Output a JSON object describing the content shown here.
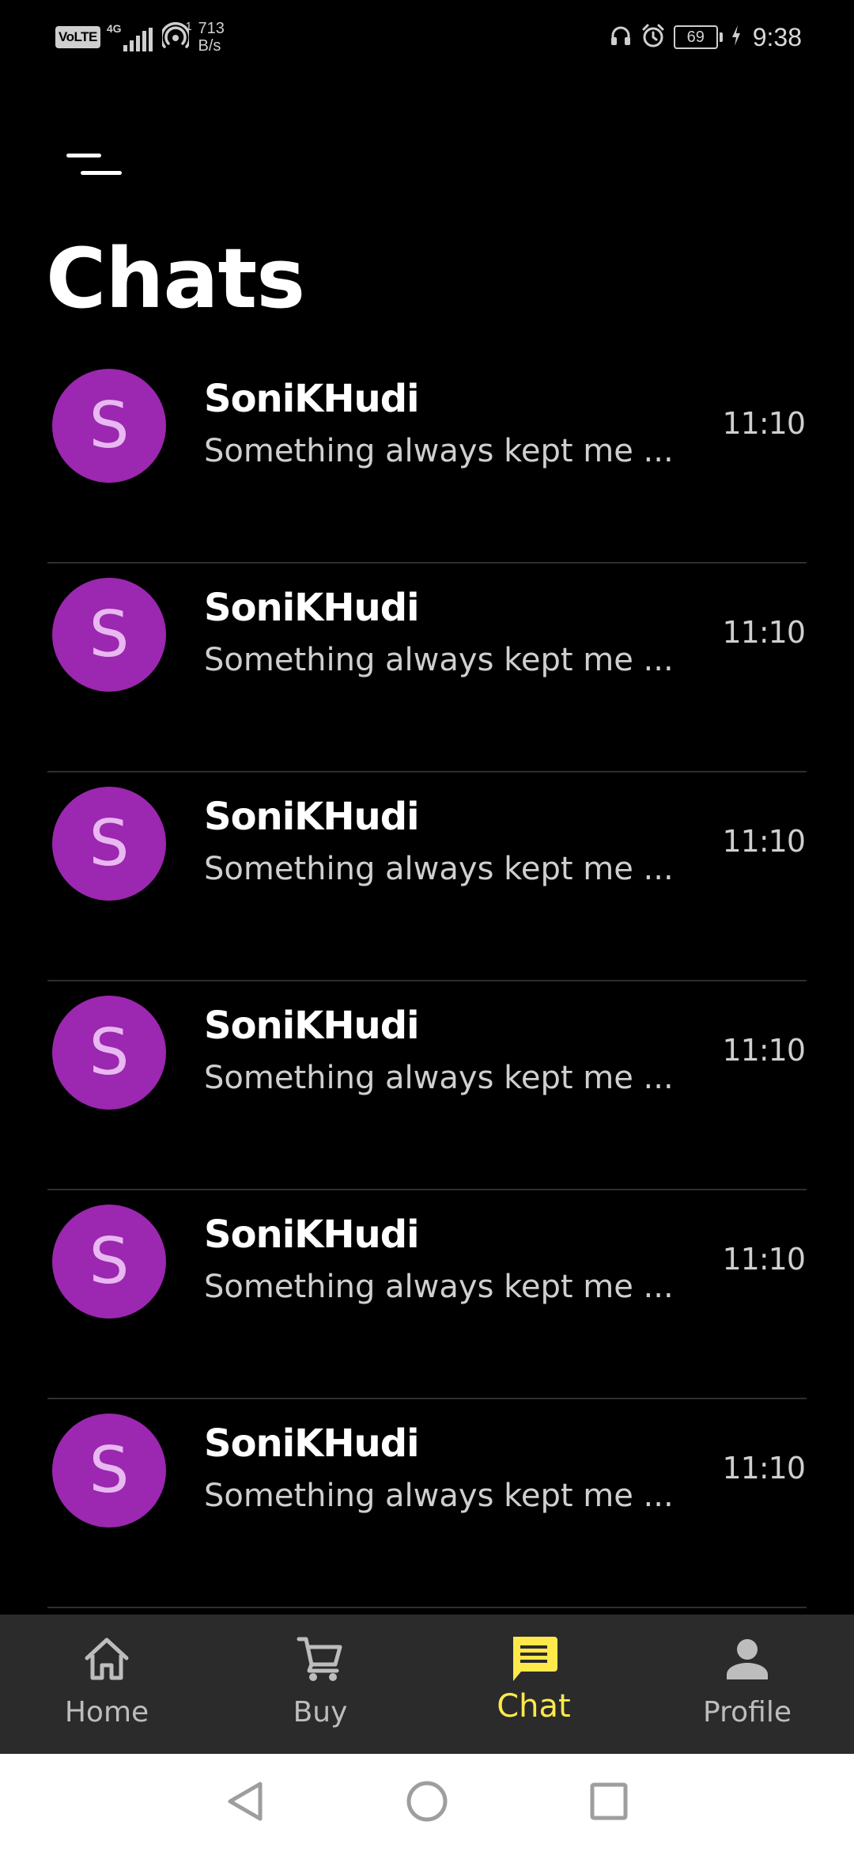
{
  "status_bar": {
    "volte": "VoLTE",
    "network": "4G",
    "speed_sup": "1",
    "speed_value": "713",
    "speed_unit": "B/s",
    "battery": "69",
    "time": "9:38"
  },
  "header": {
    "title": "Chats"
  },
  "chats": [
    {
      "avatar_letter": "S",
      "name": "SoniKHudi",
      "preview": "Something always kept me ...",
      "time": "11:10"
    },
    {
      "avatar_letter": "S",
      "name": "SoniKHudi",
      "preview": "Something always kept me ...",
      "time": "11:10"
    },
    {
      "avatar_letter": "S",
      "name": "SoniKHudi",
      "preview": "Something always kept me ...",
      "time": "11:10"
    },
    {
      "avatar_letter": "S",
      "name": "SoniKHudi",
      "preview": "Something always kept me ...",
      "time": "11:10"
    },
    {
      "avatar_letter": "S",
      "name": "SoniKHudi",
      "preview": "Something always kept me ...",
      "time": "11:10"
    },
    {
      "avatar_letter": "S",
      "name": "SoniKHudi",
      "preview": "Something always kept me ...",
      "time": "11:10"
    }
  ],
  "bottom_nav": {
    "items": [
      {
        "label": "Home",
        "icon": "home-icon",
        "active": false
      },
      {
        "label": "Buy",
        "icon": "cart-icon",
        "active": false
      },
      {
        "label": "Chat",
        "icon": "chat-icon",
        "active": true
      },
      {
        "label": "Profile",
        "icon": "person-icon",
        "active": false
      }
    ]
  },
  "colors": {
    "background": "#000000",
    "avatar": "#9c27b0",
    "avatar_letter": "#e8b8f0",
    "nav_background": "#2b2b2b",
    "nav_active": "#ffe94a",
    "nav_inactive": "#bdbdbd"
  }
}
